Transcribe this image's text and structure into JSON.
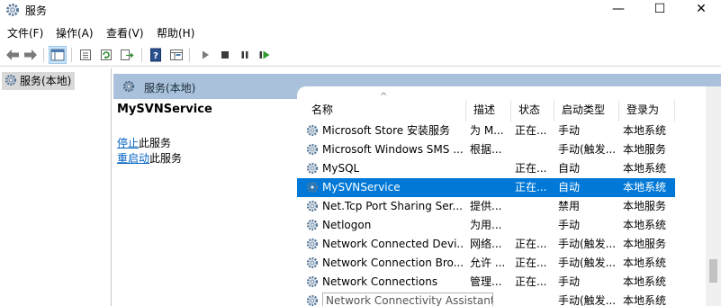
{
  "window": {
    "title": "服务",
    "minimize": "—",
    "maximize": "☐",
    "close": "✕"
  },
  "menu": [
    "文件(F)",
    "操作(A)",
    "查看(V)",
    "帮助(H)"
  ],
  "toolbar": {
    "icons": [
      "back-arrow-icon",
      "forward-arrow-icon",
      "console-tree-icon",
      "properties-icon",
      "refresh-icon",
      "export-list-icon",
      "help-icon",
      "extended-view-icon",
      "start-service-icon",
      "stop-service-icon",
      "pause-service-icon",
      "restart-service-icon"
    ]
  },
  "tree": {
    "selected": "服务(本地)"
  },
  "header": {
    "title": "服务(本地)"
  },
  "detail": {
    "service_name": "MySVNService",
    "stop_link": "停止",
    "stop_suffix": "此服务",
    "restart_link": "重启动",
    "restart_suffix": "此服务"
  },
  "columns": {
    "sort_indicator": "^",
    "name": "名称",
    "description": "描述",
    "status": "状态",
    "startup": "启动类型",
    "logon": "登录为"
  },
  "rows": [
    {
      "name": "Microsoft Store 安装服务",
      "description": "为 M...",
      "status": "正在...",
      "startup": "手动",
      "logon": "本地系统"
    },
    {
      "name": "Microsoft Windows SMS ...",
      "description": "根据...",
      "status": "",
      "startup": "手动(触发...",
      "logon": "本地服务"
    },
    {
      "name": "MySQL",
      "description": "",
      "status": "正在...",
      "startup": "自动",
      "logon": "本地系统"
    },
    {
      "name": "MySVNService",
      "description": "",
      "status": "正在...",
      "startup": "自动",
      "logon": "本地系统"
    },
    {
      "name": "Net.Tcp Port Sharing Ser...",
      "description": "提供...",
      "status": "",
      "startup": "禁用",
      "logon": "本地服务"
    },
    {
      "name": "Netlogon",
      "description": "为用...",
      "status": "",
      "startup": "手动",
      "logon": "本地系统"
    },
    {
      "name": "Network Connected Devi...",
      "description": "网络...",
      "status": "正在...",
      "startup": "手动(触发...",
      "logon": "本地服务"
    },
    {
      "name": "Network Connection Bro...",
      "description": "允许 ...",
      "status": "正在...",
      "startup": "手动(触发...",
      "logon": "本地系统"
    },
    {
      "name": "Network Connections",
      "description": "管理...",
      "status": "正在...",
      "startup": "手动",
      "logon": "本地系统"
    },
    {
      "name": "Network Connectivity Assistant",
      "description": "",
      "status": "",
      "startup": "手动(触发...",
      "logon": "本地系统"
    }
  ],
  "selected_row": 3,
  "colors": {
    "header_band": "#a9c1da",
    "selection": "#0078d7",
    "link": "#0563c1",
    "tree_selected": "#d9d9d9"
  }
}
